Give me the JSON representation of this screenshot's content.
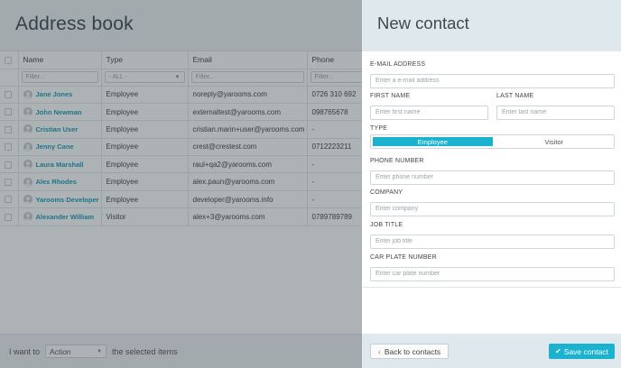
{
  "address_book": {
    "title": "Address book",
    "columns": [
      "Name",
      "Type",
      "Email",
      "Phone"
    ],
    "filters": {
      "name_placeholder": "Filter...",
      "type_value": "- ALL -",
      "email_placeholder": "Filter...",
      "phone_placeholder": "Filter..."
    },
    "rows": [
      {
        "name": "Jane Jones",
        "type": "Employee",
        "email": "noreply@yarooms.com",
        "phone": "0726 310 692"
      },
      {
        "name": "John Newman",
        "type": "Employee",
        "email": "externaltest@yarooms.com",
        "phone": "098765678"
      },
      {
        "name": "Cristian User",
        "type": "Employee",
        "email": "cristian.marin+user@yarooms.com",
        "phone": "-"
      },
      {
        "name": "Jenny Cane",
        "type": "Employee",
        "email": "crest@crestest.com",
        "phone": "0712223211"
      },
      {
        "name": "Laura Marshall",
        "type": "Employee",
        "email": "raul+qa2@yarooms.com",
        "phone": "-"
      },
      {
        "name": "Alex Rhodes",
        "type": "Employee",
        "email": "alex.paun@yarooms.com",
        "phone": "-"
      },
      {
        "name": "Yarooms Developer",
        "type": "Employee",
        "email": "developer@yarooms.info",
        "phone": "-"
      },
      {
        "name": "Alexander William",
        "type": "Visitor",
        "email": "alex+3@yarooms.com",
        "phone": "0789789789"
      }
    ],
    "footer": {
      "prefix": "I want to",
      "action_value": "Action",
      "suffix": "the selected items"
    }
  },
  "new_contact": {
    "title": "New contact",
    "email": {
      "label": "E-MAIL ADDRESS",
      "placeholder": "Enter a e-mail address"
    },
    "first_name": {
      "label": "FIRST NAME",
      "placeholder": "Enter first name"
    },
    "last_name": {
      "label": "LAST NAME",
      "placeholder": "Enter last name"
    },
    "type": {
      "label": "TYPE",
      "options": [
        "Employee",
        "Visitor"
      ],
      "selected": "Employee"
    },
    "phone": {
      "label": "PHONE NUMBER",
      "placeholder": "Enter phone number"
    },
    "company": {
      "label": "COMPANY",
      "placeholder": "Enter company"
    },
    "job_title": {
      "label": "JOB TITLE",
      "placeholder": "Enter job title"
    },
    "car_plate": {
      "label": "CAR PLATE NUMBER",
      "placeholder": "Enter car plate number"
    },
    "back_label": "Back to contacts",
    "save_label": "Save contact"
  },
  "colors": {
    "accent": "#1ab2ce",
    "link": "#1a9db9",
    "header_bg": "#dfe8ec"
  }
}
